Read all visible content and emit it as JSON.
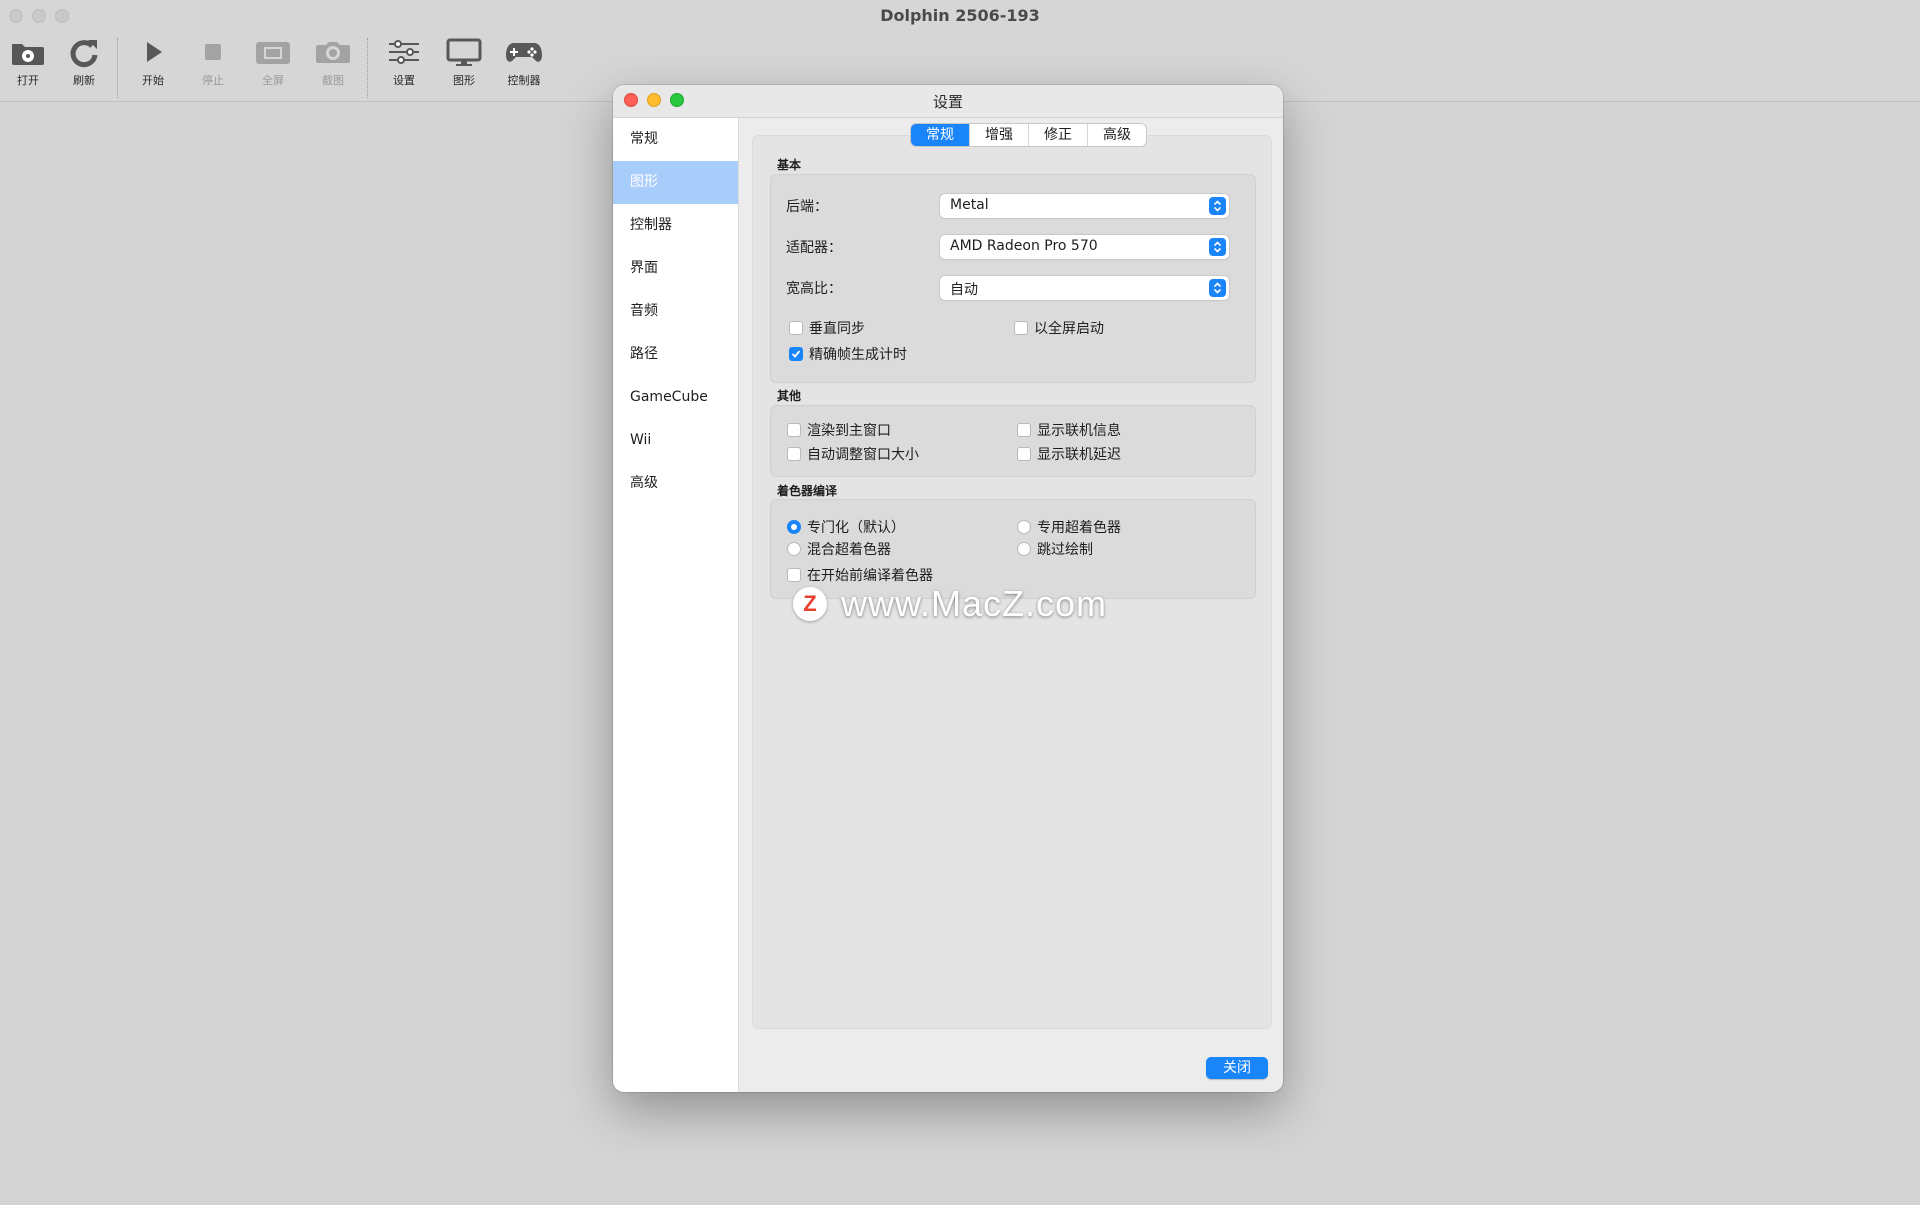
{
  "app": {
    "title": "Dolphin 2506-193"
  },
  "toolbar": {
    "buttons": [
      {
        "label": "打开",
        "icon": "open-disc-icon",
        "enabled": true
      },
      {
        "label": "刷新",
        "icon": "refresh-icon",
        "enabled": true
      },
      {
        "label": "开始",
        "icon": "play-icon",
        "enabled": true
      },
      {
        "label": "停止",
        "icon": "stop-icon",
        "enabled": false
      },
      {
        "label": "全屏",
        "icon": "fullscreen-icon",
        "enabled": false
      },
      {
        "label": "截图",
        "icon": "camera-icon",
        "enabled": false
      },
      {
        "label": "设置",
        "icon": "sliders-icon",
        "enabled": true
      },
      {
        "label": "图形",
        "icon": "monitor-icon",
        "enabled": true
      },
      {
        "label": "控制器",
        "icon": "gamepad-icon",
        "enabled": true
      }
    ]
  },
  "dialog": {
    "title": "设置",
    "sidebar": {
      "items": [
        "常规",
        "图形",
        "控制器",
        "界面",
        "音频",
        "路径",
        "GameCube",
        "Wii",
        "高级"
      ],
      "selected": "图形"
    },
    "tabs": {
      "items": [
        "常规",
        "增强",
        "修正",
        "高级"
      ],
      "active": "常规"
    },
    "basic": {
      "title": "基本",
      "backend_label": "后端：",
      "backend_value": "Metal",
      "adapter_label": "适配器：",
      "adapter_value": "AMD Radeon Pro 570",
      "aspect_label": "宽高比：",
      "aspect_value": "自动",
      "vsync_label": "垂直同步",
      "vsync_checked": false,
      "fullscreen_start_label": "以全屏启动",
      "fullscreen_start_checked": false,
      "precise_frame_label": "精确帧生成计时",
      "precise_frame_checked": true
    },
    "other": {
      "title": "其他",
      "render_main_label": "渲染到主窗口",
      "auto_resize_label": "自动调整窗口大小",
      "netplay_info_label": "显示联机信息",
      "netplay_ping_label": "显示联机延迟"
    },
    "shader": {
      "title": "着色器编译",
      "specialized_label": "专门化（默认）",
      "exclusive_uber_label": "专用超着色器",
      "hybrid_uber_label": "混合超着色器",
      "skip_drawing_label": "跳过绘制",
      "selected": "专门化（默认）",
      "compile_before_label": "在开始前编译着色器"
    },
    "close_label": "关闭"
  },
  "watermark": {
    "logo_letter": "Z",
    "text": "www.MacZ.com"
  },
  "colors": {
    "accent": "#1a84f9",
    "sidebar_selected": "#a9cdfb"
  }
}
